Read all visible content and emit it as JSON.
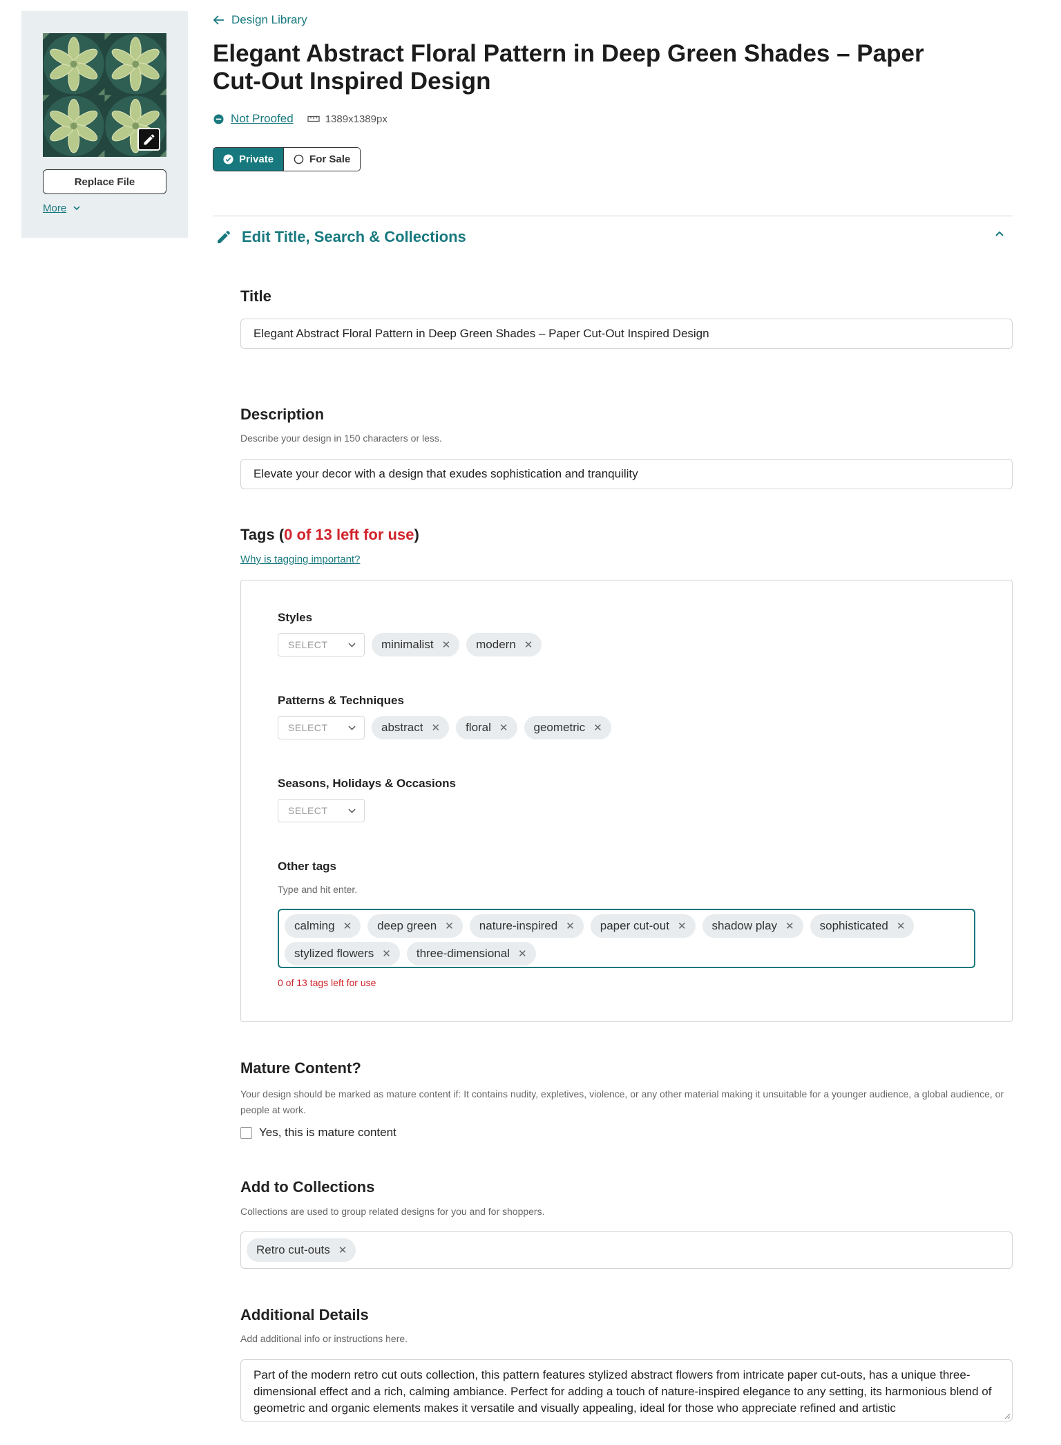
{
  "sidebar": {
    "replace_label": "Replace File",
    "more_label": "More"
  },
  "header": {
    "back_label": "Design Library",
    "title": "Elegant Abstract Floral Pattern in Deep Green Shades – Paper Cut-Out Inspired Design",
    "proof_status": "Not Proofed",
    "dimensions": "1389x1389px",
    "visibility": {
      "private": "Private",
      "for_sale": "For Sale",
      "selected": "Private"
    }
  },
  "section": {
    "title": "Edit Title, Search & Collections"
  },
  "form": {
    "title_label": "Title",
    "title_value": "Elegant Abstract Floral Pattern in Deep Green Shades – Paper Cut-Out Inspired Design",
    "description_label": "Description",
    "description_hint": "Describe your design in 150 characters or less.",
    "description_value": "Elevate your decor with a design that exudes sophistication and tranquility"
  },
  "tags": {
    "title_prefix": "Tags (",
    "remaining_text": "0 of 13 left for use",
    "title_suffix": ")",
    "why_link": "Why is tagging important?",
    "select_placeholder": "SELECT",
    "styles": {
      "label": "Styles",
      "items": [
        "minimalist",
        "modern"
      ]
    },
    "patterns": {
      "label": "Patterns & Techniques",
      "items": [
        "abstract",
        "floral",
        "geometric"
      ]
    },
    "seasons": {
      "label": "Seasons, Holidays & Occasions",
      "items": []
    },
    "other": {
      "label": "Other tags",
      "hint": "Type and hit enter.",
      "items": [
        "calming",
        "deep green",
        "nature-inspired",
        "paper cut-out",
        "shadow play",
        "sophisticated",
        "stylized flowers",
        "three-dimensional"
      ],
      "count_text": "0 of 13 tags left for use"
    }
  },
  "mature": {
    "label": "Mature Content?",
    "hint": "Your design should be marked as mature content if: It contains nudity, expletives, violence, or any other material making it unsuitable for a younger audience, a global audience, or people at work.",
    "checkbox_label": "Yes, this is mature content",
    "checked": false
  },
  "collections": {
    "label": "Add to Collections",
    "hint": "Collections are used to group related designs for you and for shoppers.",
    "items": [
      "Retro cut-outs"
    ]
  },
  "details": {
    "label": "Additional Details",
    "hint": "Add additional info or instructions here.",
    "value": "Part of the modern retro cut outs collection, this pattern features stylized abstract flowers from intricate paper cut-outs, has a unique three-dimensional effect and a rich, calming ambiance. Perfect for adding a touch of nature-inspired elegance to any setting, its harmonious blend of geometric and organic elements makes it versatile and visually appealing, ideal for those who appreciate refined and artistic"
  },
  "colors": {
    "accent": "#17797e",
    "warning": "#d0232a",
    "panel": "#e9eef0"
  }
}
